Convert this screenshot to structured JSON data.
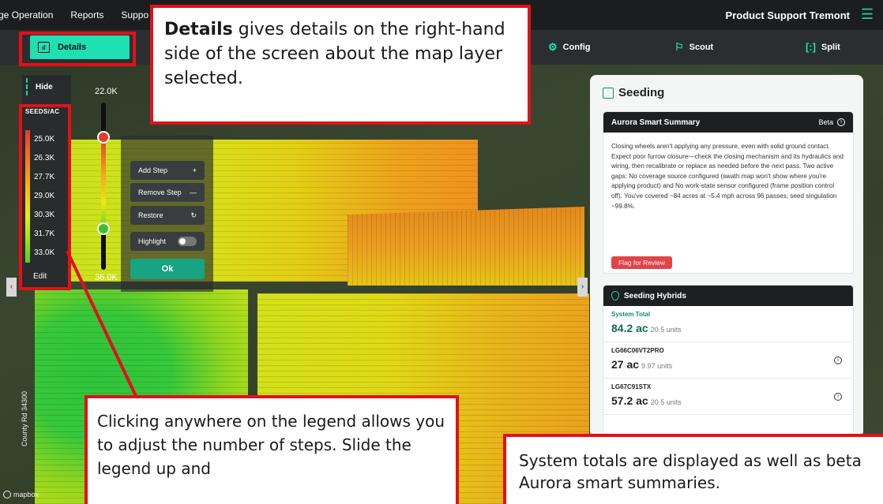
{
  "topbar": {
    "nav": [
      "ge Operation",
      "Reports",
      "Suppo"
    ],
    "brand": "Product Support Tremont",
    "menu_icon": "hamburger-icon"
  },
  "toolbar": {
    "details": "Details",
    "config": "Config",
    "scout": "Scout",
    "split": "Split"
  },
  "legend": {
    "hide": "Hide",
    "unit": "SEEDS/AC",
    "items": [
      "25.0K",
      "26.3K",
      "27.7K",
      "29.0K",
      "30.3K",
      "31.7K",
      "33.0K"
    ],
    "edit": "Edit"
  },
  "slider": {
    "top_value": "22.0K",
    "bottom_value": "36.0K"
  },
  "steps": {
    "add": "Add Step",
    "remove": "Remove Step",
    "restore": "Restore",
    "highlight": "Highlight",
    "ok": "Ok"
  },
  "details_panel": {
    "title": "Seeding",
    "summary": {
      "title": "Aurora Smart Summary",
      "badge": "Beta",
      "text": "Closing wheels aren't applying any pressure, even with solid ground contact. Expect poor furrow closure—check the closing mechanism and its hydraulics and wiring, then recalibrate or replace as needed before the next pass. Two active gaps: No coverage source configured (swath map won't show where you're applying product) and No work-state sensor configured (frame position control off). You've covered ~84 acres at ~5.4 mph across 96 passes; seed singulation ~99.8%.",
      "flag": "Flag for Review"
    },
    "hybrids": {
      "title": "Seeding Hybrids",
      "rows": [
        {
          "name": "System Total",
          "value": "84.2 ac",
          "units": "20.5 units"
        },
        {
          "name": "LG66C06VT2PRO",
          "value": "27 ac",
          "units": "9.97 units"
        },
        {
          "name": "LG67C91STX",
          "value": "57.2 ac",
          "units": "20.5 units"
        }
      ]
    }
  },
  "callouts": {
    "details_bold": "Details",
    "details_rest": " gives details on the right-hand side of the screen about the map layer selected.",
    "legend": "Clicking anywhere on the legend allows you to adjust the number of steps. Slide the legend up and",
    "totals": "System totals are displayed as well as beta Aurora smart summaries."
  },
  "map": {
    "road": "County Rd 34300",
    "attribution": "mapbox"
  }
}
